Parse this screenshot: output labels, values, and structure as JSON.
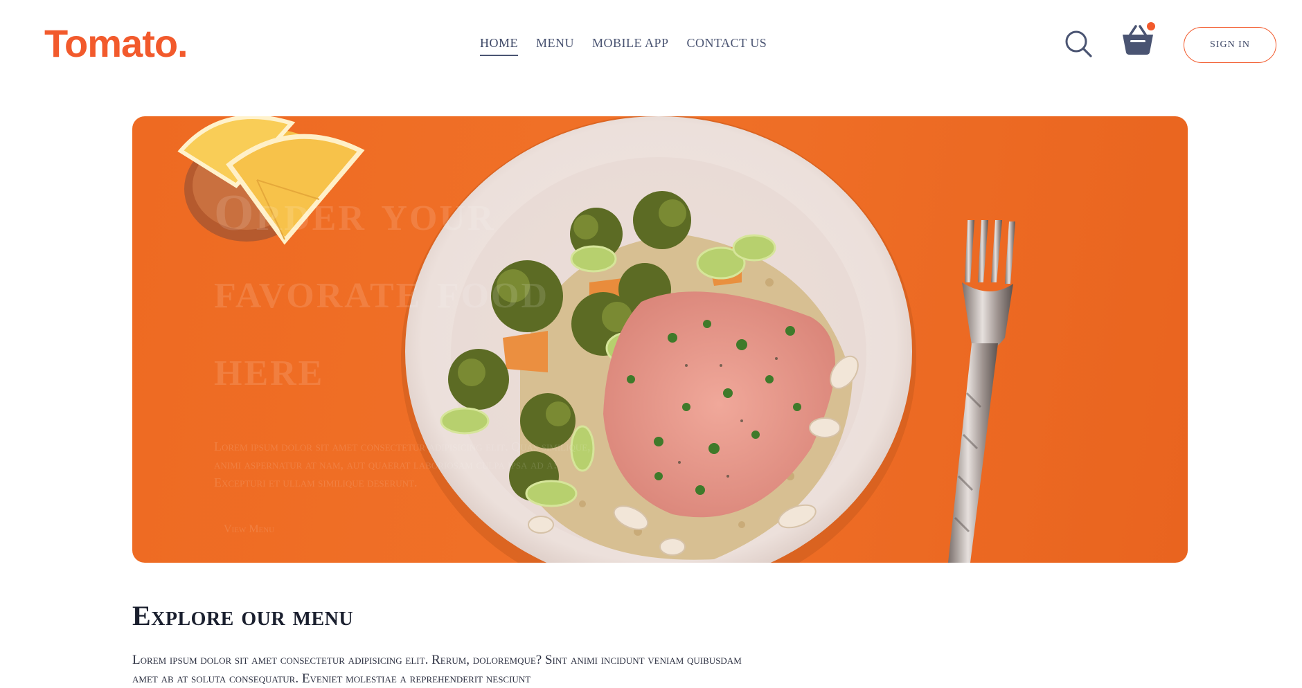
{
  "brand": {
    "logo_text": "Tomato.",
    "accent_color": "#f25a2c"
  },
  "navbar": {
    "links": [
      {
        "label": "home",
        "active": true
      },
      {
        "label": "menu",
        "active": false
      },
      {
        "label": "mobile app",
        "active": false
      },
      {
        "label": "contact us",
        "active": false
      }
    ],
    "search_icon": "search-icon",
    "cart_icon": "basket-icon",
    "cart_has_items": true,
    "sign_in_label": "sign in"
  },
  "hero": {
    "title_line1": "Order your",
    "title_line2": "favorate food",
    "title_line3": "here",
    "description": "Lorem ipsum dolor sit amet consectetur adipisicing elit. Quas similique, animi aspernatur at nam, aut quaerat laboriosam culpa ipsa ad a! Excepturi et ullam similique deserunt.",
    "button_label": "View Menu",
    "background_color": "#ee6a22"
  },
  "explore": {
    "title": "Explore our menu",
    "description": "Lorem ipsum dolor sit amet consectetur adipisicing elit. Rerum, doloremque? Sint animi incidunt veniam quibusdam amet ab at soluta consequatur. Eveniet molestiae a reprehenderit nesciunt"
  }
}
